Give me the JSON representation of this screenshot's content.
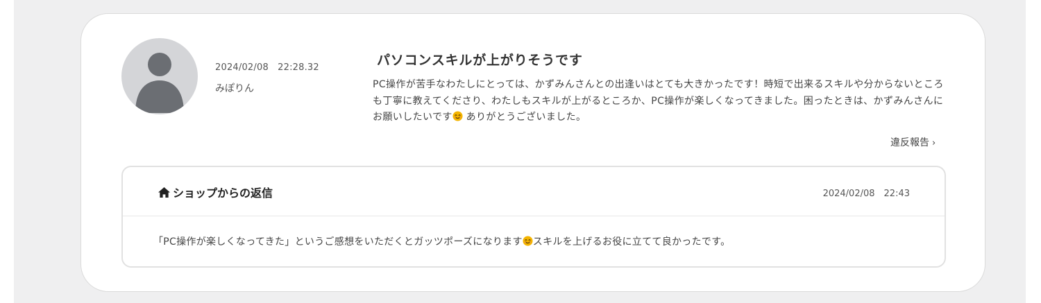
{
  "review": {
    "date": "2024/02/08　22:28.32",
    "author": "みぽりん",
    "title": "パソコンスキルが上がりそうです",
    "body_before_emoji": "PC操作が苦手なわたしにとっては、かずみんさんとの出逢いはとても大きかったです！時短で出来るスキルや分からないところも丁寧に教えてくださり、わたしもスキルが上がるところか、PC操作が楽しくなってきました。困ったときは、かずみんさんにお願いしたいです",
    "body_after_emoji": " ありがとうございました。",
    "report_label": "違反報告",
    "avatar_icon": "user-silhouette-icon",
    "emoji_icon": "smiling-face-icon"
  },
  "reply": {
    "icon": "home-icon",
    "title": "ショップからの返信",
    "date": "2024/02/08　22:43",
    "body_before_emoji": "「PC操作が楽しくなってきた」というご感想をいただくとガッツポーズになります",
    "body_after_emoji": "スキルを上げるお役に立てて良かったです。"
  },
  "colors": {
    "page_background": "#efeff0",
    "card_background": "#ffffff",
    "avatar_background": "#d4d5d8",
    "avatar_figure": "#6b6e73",
    "emoji": "#f4b400"
  }
}
